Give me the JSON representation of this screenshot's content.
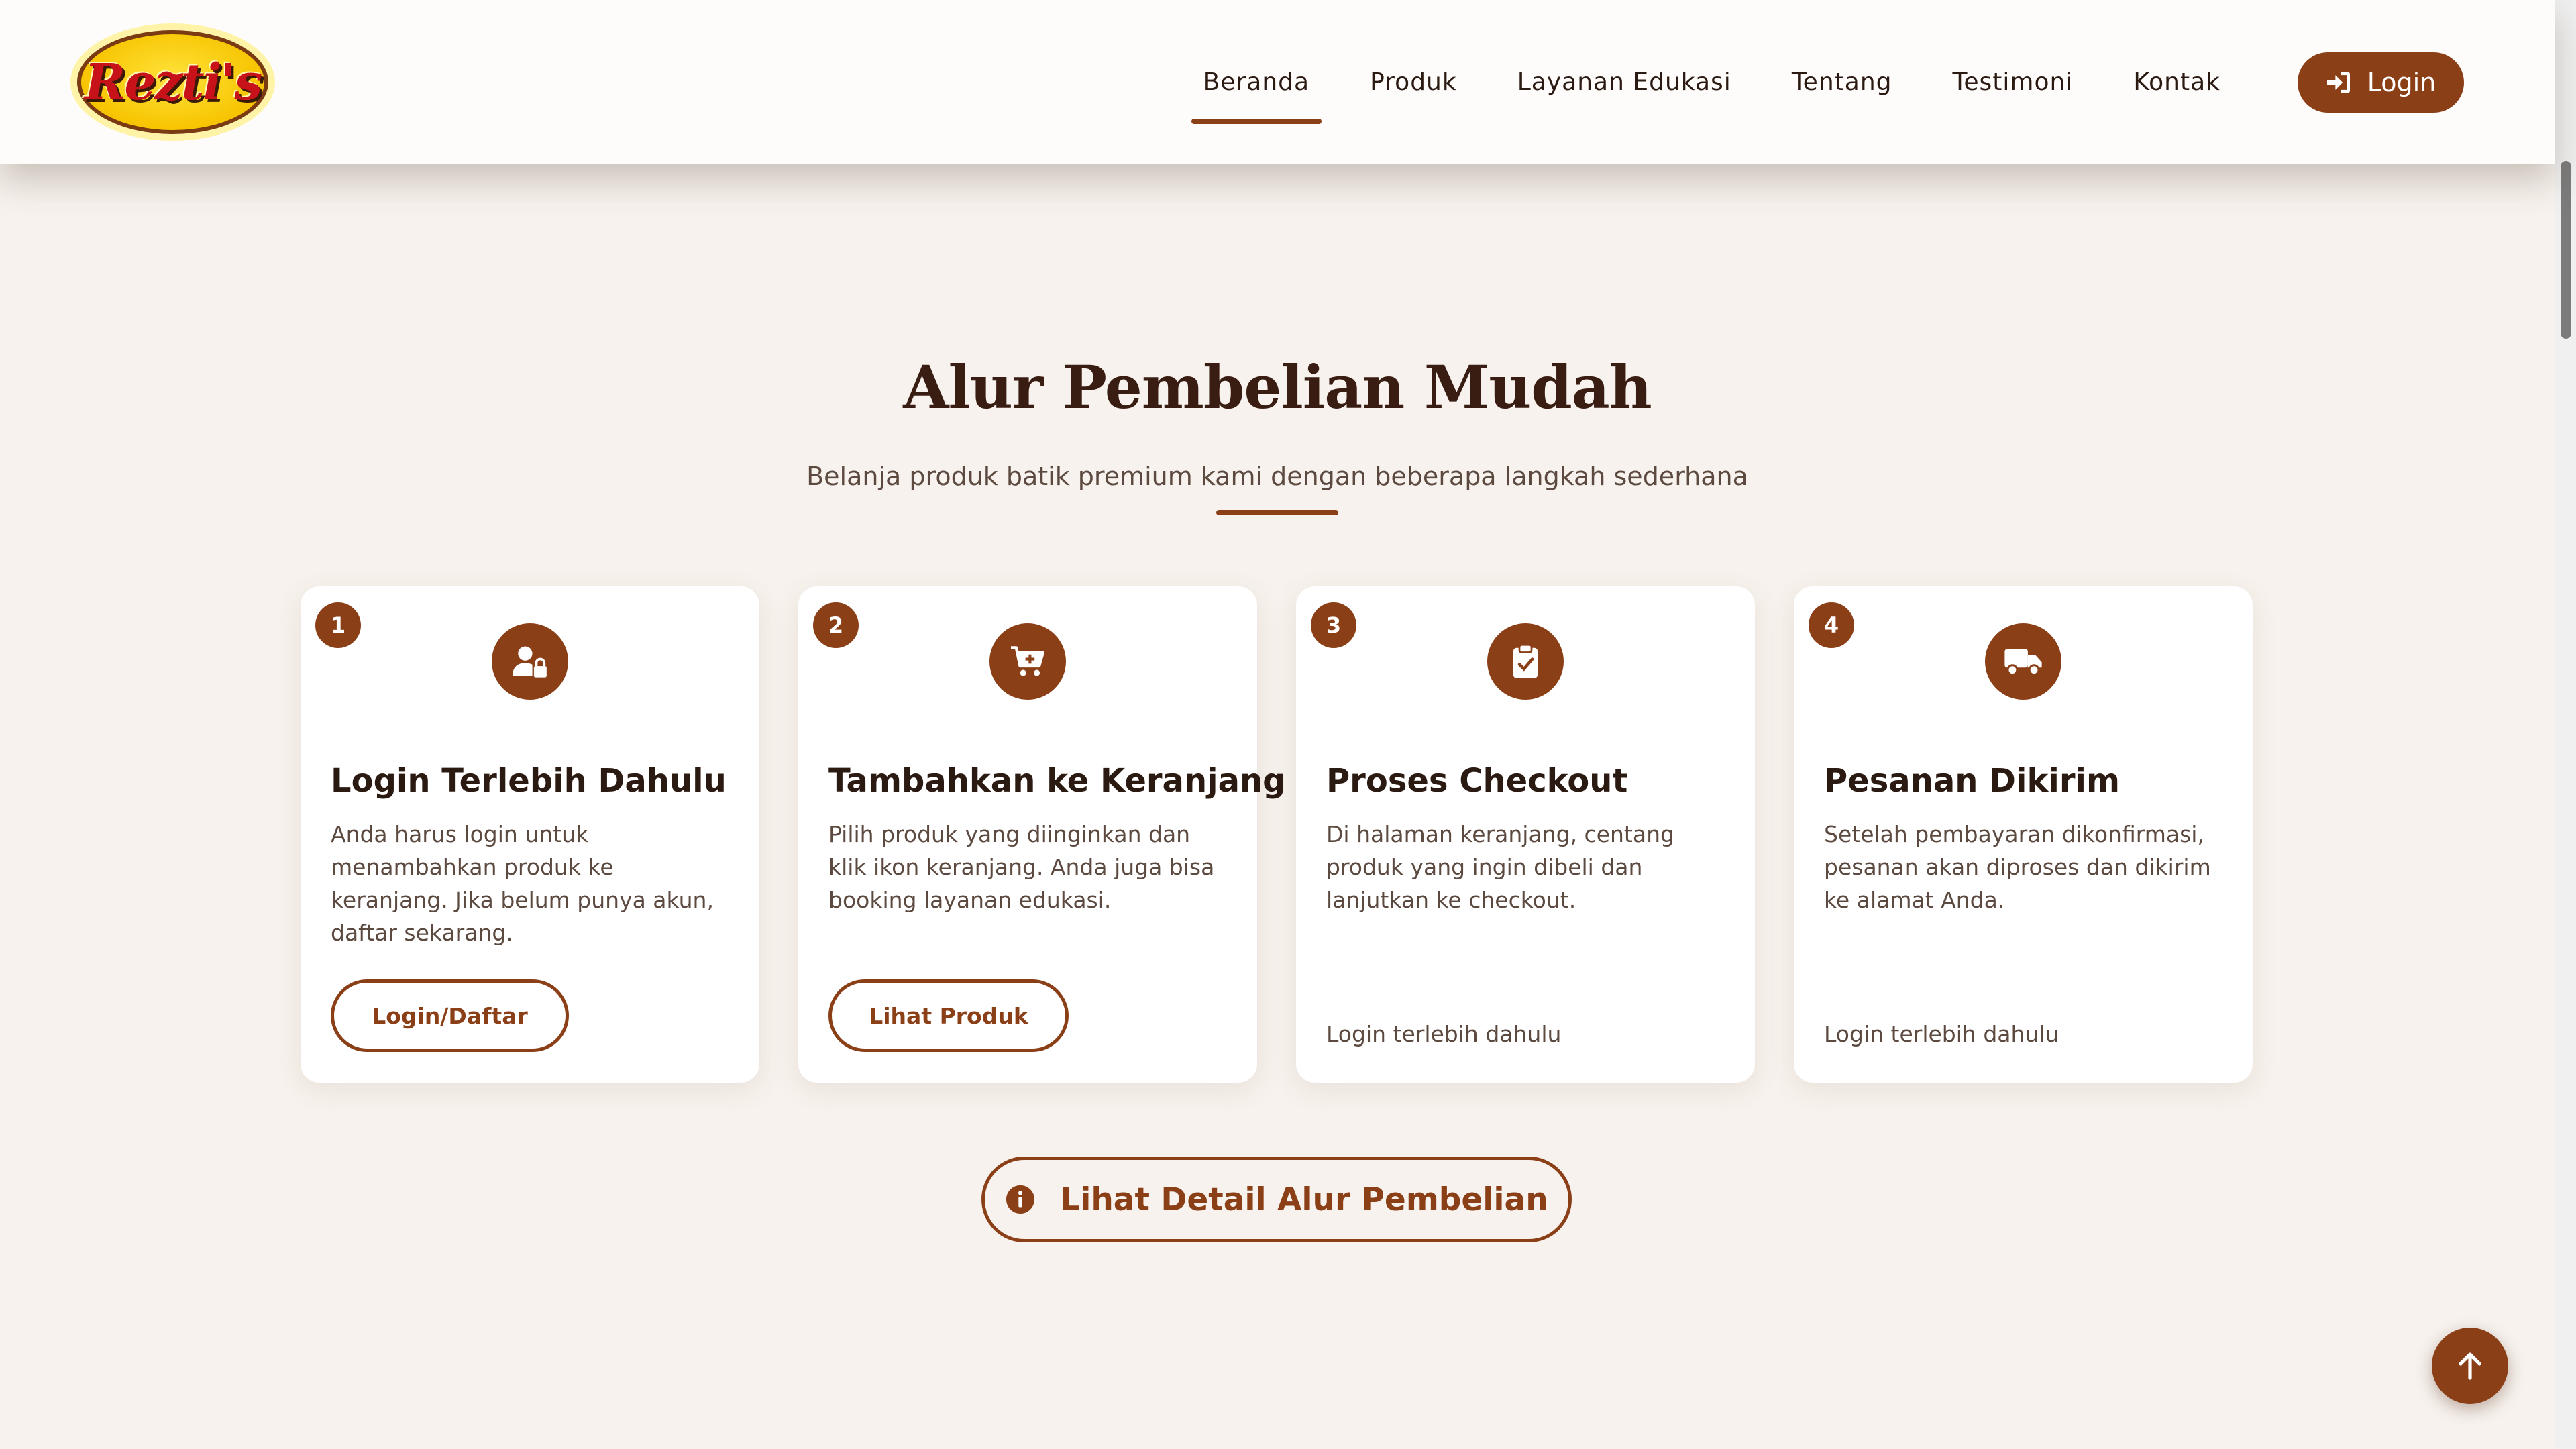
{
  "brand": {
    "logo_text": "Rezti's"
  },
  "nav": {
    "links": [
      "Beranda",
      "Produk",
      "Layanan Edukasi",
      "Tentang",
      "Testimoni",
      "Kontak"
    ],
    "active": "Beranda",
    "login_label": "Login"
  },
  "section": {
    "title": "Alur Pembelian Mudah",
    "subtitle": "Belanja produk batik premium kami dengan beberapa langkah sederhana"
  },
  "steps": [
    {
      "number": "1",
      "icon": "user-lock-icon",
      "title": "Login Terlebih Dahulu",
      "description": "Anda harus login untuk menambahkan produk ke keranjang. Jika belum punya akun, daftar sekarang.",
      "button_label": "Login/Daftar"
    },
    {
      "number": "2",
      "icon": "cart-plus-icon",
      "title": "Tambahkan ke Keranjang",
      "description": "Pilih produk yang diinginkan dan klik ikon keranjang. Anda juga bisa booking layanan edukasi.",
      "button_label": "Lihat Produk"
    },
    {
      "number": "3",
      "icon": "clipboard-check-icon",
      "title": "Proses Checkout",
      "description": "Di halaman keranjang, centang produk yang ingin dibeli dan lanjutkan ke checkout.",
      "note": "Login terlebih dahulu"
    },
    {
      "number": "4",
      "icon": "truck-icon",
      "title": "Pesanan Dikirim",
      "description": "Setelah pembayaran dikonfirmasi, pesanan akan diproses dan dikirim ke alamat Anda.",
      "note": "Login terlebih dahulu"
    }
  ],
  "detail_button_label": "Lihat Detail Alur Pembelian",
  "colors": {
    "accent": "#8b3f17",
    "background": "#f7f2ed",
    "logo_yellow": "#f7c400",
    "logo_red": "#c8121a"
  }
}
